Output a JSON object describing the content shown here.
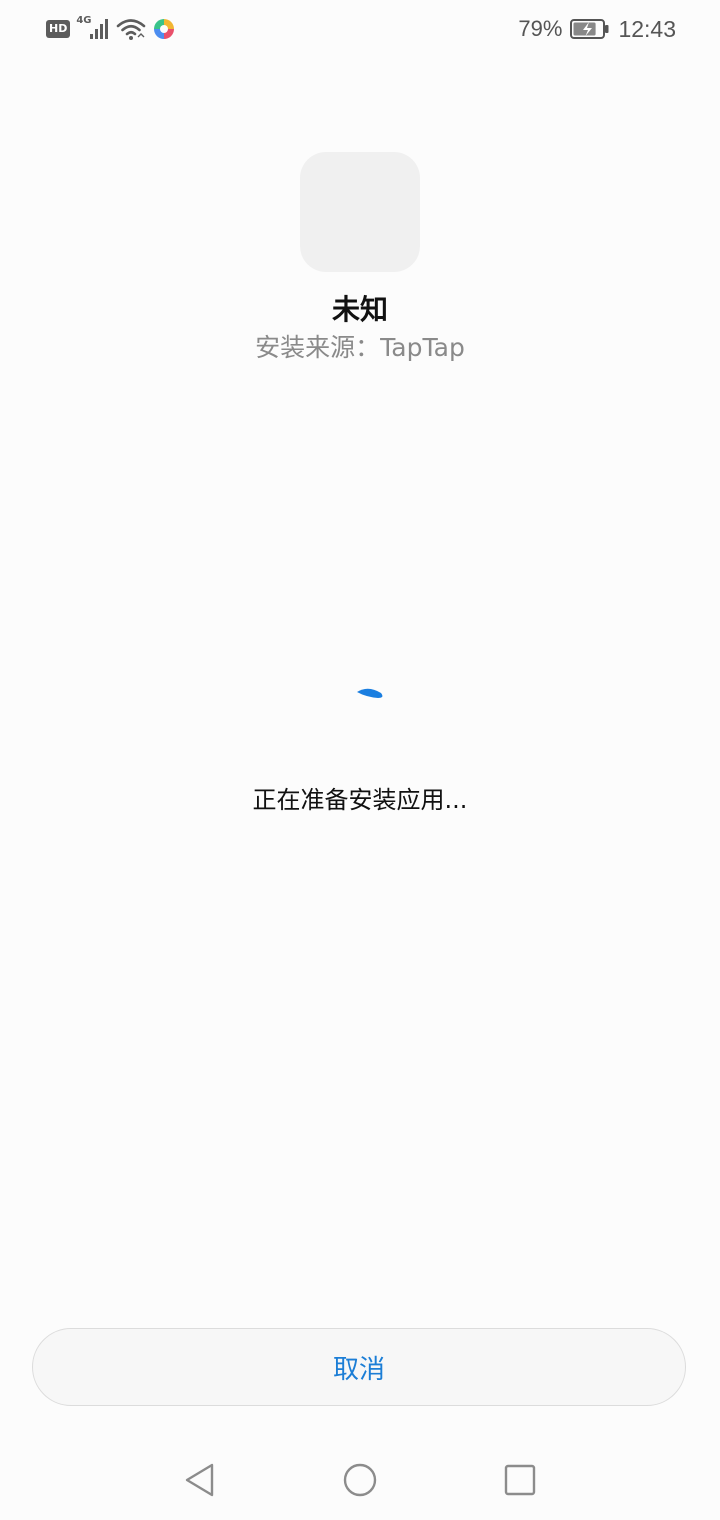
{
  "status_bar": {
    "hd_label": "HD",
    "network_label": "4G",
    "battery_percent": "79%",
    "battery_level": 0.79,
    "time": "12:43",
    "icons": [
      "hd-icon",
      "signal-icon",
      "wifi-icon",
      "app-notification-icon",
      "battery-charging-icon"
    ]
  },
  "app": {
    "name": "未知",
    "install_source": "安装来源：TapTap",
    "icon": "app-placeholder-icon"
  },
  "progress": {
    "text": "正在准备安装应用...",
    "spinner_color": "#1a7ee0"
  },
  "actions": {
    "cancel_label": "取消"
  },
  "nav_bar": {
    "icons": [
      "back-icon",
      "home-icon",
      "recents-icon"
    ]
  },
  "colors": {
    "accent": "#1c7ed6",
    "background": "#fcfcfc"
  }
}
